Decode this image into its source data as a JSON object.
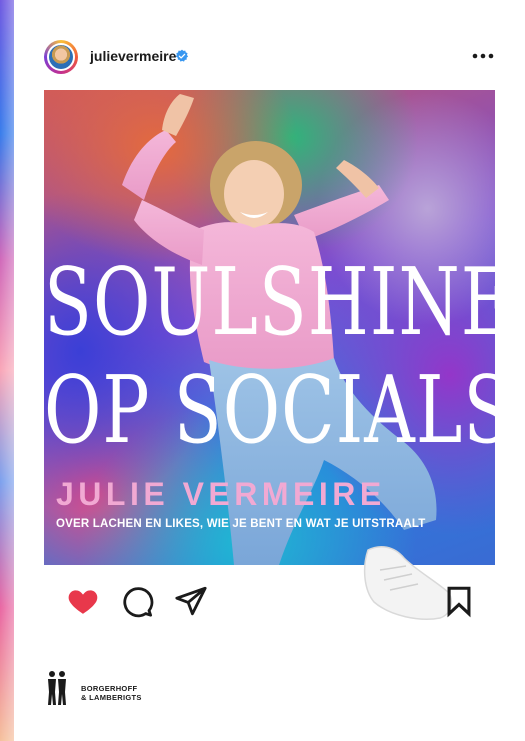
{
  "post": {
    "username": "julievermeire",
    "title_line1": "SOULSHINE",
    "title_line2": "OP SOCIALS",
    "author": "JULIE VERMEIRE",
    "subtitle": "OVER LACHEN EN LIKES, WIE JE BENT EN WAT JE UITSTRAALT"
  },
  "icons": {
    "verified": "verified-badge-icon",
    "more": "more-options-icon",
    "like": "heart-icon",
    "comment": "comment-icon",
    "share": "send-icon",
    "save": "bookmark-icon"
  },
  "publisher": {
    "line1": "BORGERHOFF",
    "line2": "& LAMBERIGTS"
  },
  "colors": {
    "like_red": "#e8384b",
    "verified_blue": "#3897f0",
    "author_pink": "#f1a9d3",
    "text_dark": "#1b1b1b"
  }
}
